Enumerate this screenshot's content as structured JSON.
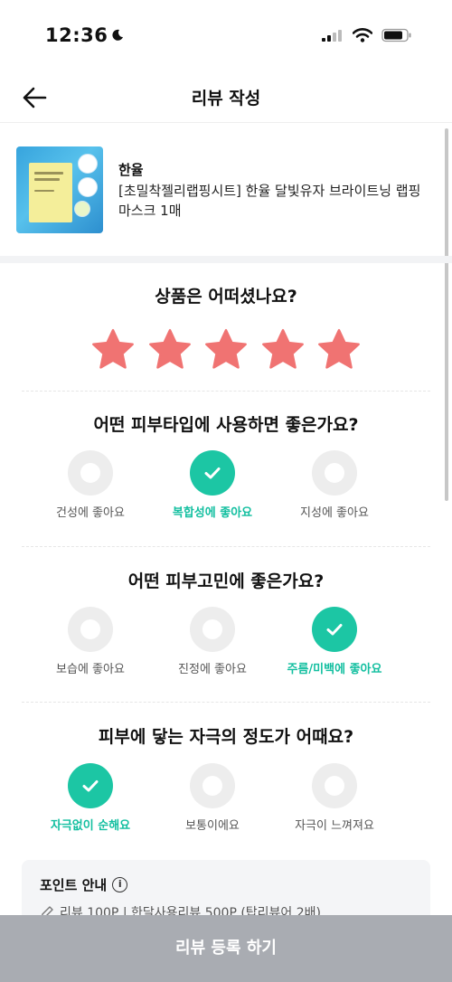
{
  "status_bar": {
    "time": "12:36"
  },
  "header": {
    "title": "리뷰 작성"
  },
  "product": {
    "brand": "한율",
    "name": "[초밀착젤리랩핑시트] 한율 달빛유자 브라이트닝 랩핑 마스크 1매"
  },
  "rating": {
    "question": "상품은 어떠셨나요?",
    "value": 5,
    "max": 5,
    "star_color": "#f07372"
  },
  "questions": [
    {
      "title": "어떤 피부타입에 사용하면 좋은가요?",
      "options": [
        {
          "label": "건성에 좋아요",
          "selected": false
        },
        {
          "label": "복합성에 좋아요",
          "selected": true
        },
        {
          "label": "지성에 좋아요",
          "selected": false
        }
      ]
    },
    {
      "title": "어떤 피부고민에 좋은가요?",
      "options": [
        {
          "label": "보습에 좋아요",
          "selected": false
        },
        {
          "label": "진정에 좋아요",
          "selected": false
        },
        {
          "label": "주름/미백에 좋아요",
          "selected": true
        }
      ]
    },
    {
      "title": "피부에 닿는 자극의 정도가 어때요?",
      "options": [
        {
          "label": "자극없이 순해요",
          "selected": true
        },
        {
          "label": "보통이에요",
          "selected": false
        },
        {
          "label": "자극이 느껴져요",
          "selected": false
        }
      ]
    }
  ],
  "points": {
    "title": "포인트 안내",
    "info_icon": "i",
    "line": "리뷰 100P | 한달사용리뷰 500P (탑리뷰어 2배)"
  },
  "submit_label": "리뷰 등록 하기",
  "colors": {
    "accent": "#1cc6a4",
    "accent_text": "#13bfa0",
    "submit_bg": "#a9acb2"
  }
}
